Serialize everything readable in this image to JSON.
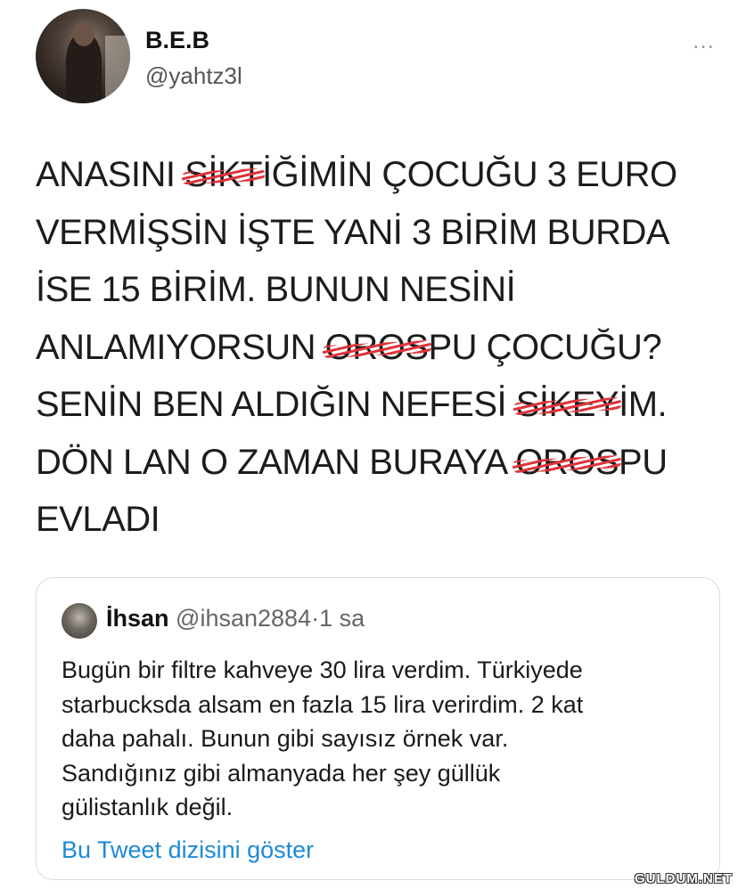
{
  "author": {
    "display_name": "B.E.B",
    "handle": "@yahtz3l"
  },
  "more_icon": "…",
  "tweet": {
    "lines": [
      [
        "ANASINI ",
        "SİKT",
        "İĞİMİN ÇOCUĞU 3 EURO"
      ],
      [
        "VERMİŞSİN İŞTE YANİ 3 BİRİM BURDA",
        "",
        ""
      ],
      [
        "İSE 15 BİRİM. BUNUN NESİNİ",
        "",
        ""
      ],
      [
        "ANLAMIYORSUN ",
        "OROS",
        "PU ÇOCUĞU?"
      ],
      [
        "SENİN BEN ALDIĞIN NEFESİ ",
        "SİKEY",
        "İM."
      ],
      [
        "DÖN LAN O ZAMAN BURAYA ",
        "OROS",
        "PU"
      ],
      [
        "EVLADI",
        "",
        ""
      ]
    ]
  },
  "quoted_tweet": {
    "name": "İhsan",
    "handle": "@ihsan2884",
    "separator": "·",
    "time": "1 sa",
    "lines": [
      "Bugün bir filtre kahveye 30 lira verdim. Türkiyede",
      "starbucksda alsam en fazla 15 lira verirdim. 2 kat",
      "daha pahalı. Bunun gibi sayısız örnek var.",
      "Sandığınız gibi almanyada her şey güllük",
      "gülistanlık değil."
    ],
    "show_thread": "Bu Tweet dizisini göster"
  },
  "watermark": "GULDUM.NET",
  "colors": {
    "link": "#1d8ad6",
    "censor": "#e0333a"
  }
}
